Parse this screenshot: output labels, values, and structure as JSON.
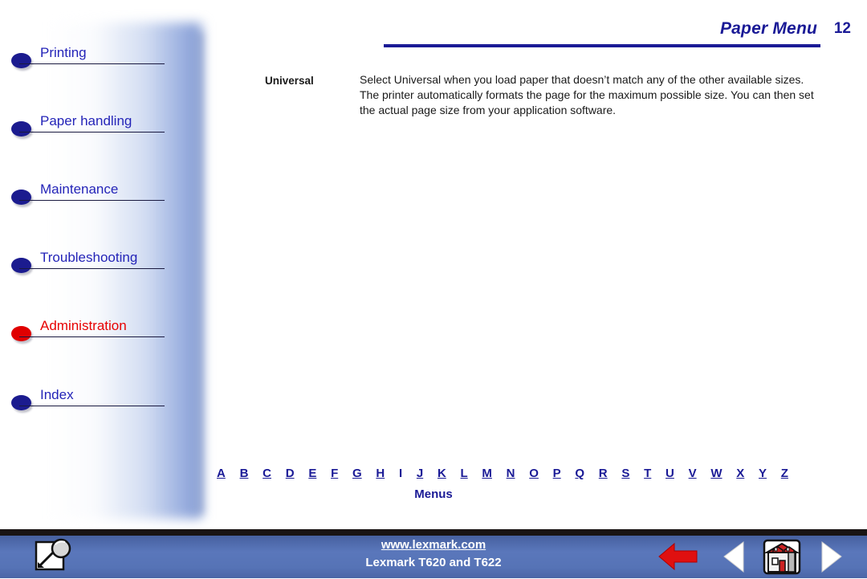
{
  "header": {
    "title": "Paper Menu",
    "page_number": "12",
    "rule_color": "#1a1a96"
  },
  "sidebar": {
    "items": [
      {
        "label": "Printing",
        "bullet": "blue",
        "active": false
      },
      {
        "label": "Paper handling",
        "bullet": "blue",
        "active": false
      },
      {
        "label": "Maintenance",
        "bullet": "blue",
        "active": false
      },
      {
        "label": "Troubleshooting",
        "bullet": "blue",
        "active": false
      },
      {
        "label": "Administration",
        "bullet": "red",
        "active": true
      },
      {
        "label": "Index",
        "bullet": "blue",
        "active": false
      }
    ],
    "active_color": "#e70000",
    "link_color": "#2424b8"
  },
  "main": {
    "entries": [
      {
        "term": "Universal",
        "description": "Select Universal when you load paper that doesn’t match any of the other available sizes. The printer automatically formats the page for the maximum possible size. You can then set the actual page size from your application software."
      }
    ]
  },
  "alpha_index": {
    "letters": [
      {
        "letter": "A",
        "underlined": true
      },
      {
        "letter": "B",
        "underlined": true
      },
      {
        "letter": "C",
        "underlined": true
      },
      {
        "letter": "D",
        "underlined": true
      },
      {
        "letter": "E",
        "underlined": true
      },
      {
        "letter": "F",
        "underlined": true
      },
      {
        "letter": "G",
        "underlined": true
      },
      {
        "letter": "H",
        "underlined": true
      },
      {
        "letter": "I",
        "underlined": false
      },
      {
        "letter": "J",
        "underlined": true
      },
      {
        "letter": "K",
        "underlined": true
      },
      {
        "letter": "L",
        "underlined": true
      },
      {
        "letter": "M",
        "underlined": true
      },
      {
        "letter": "N",
        "underlined": true
      },
      {
        "letter": "O",
        "underlined": true
      },
      {
        "letter": "P",
        "underlined": true
      },
      {
        "letter": "Q",
        "underlined": true
      },
      {
        "letter": "R",
        "underlined": true
      },
      {
        "letter": "S",
        "underlined": true
      },
      {
        "letter": "T",
        "underlined": true
      },
      {
        "letter": "U",
        "underlined": true
      },
      {
        "letter": "V",
        "underlined": true
      },
      {
        "letter": "W",
        "underlined": true
      },
      {
        "letter": "X",
        "underlined": true
      },
      {
        "letter": "Y",
        "underlined": true
      },
      {
        "letter": "Z",
        "underlined": true
      }
    ],
    "caption": "Menus"
  },
  "footer": {
    "url": "www.lexmark.com",
    "model": "Lexmark T620 and T622",
    "background_color": "#5673b6",
    "icons": {
      "search": "search-icon",
      "back": "back-arrow-icon",
      "previous": "previous-page-icon",
      "home": "home-icon",
      "next": "next-page-icon"
    },
    "back_arrow_color": "#e01010"
  }
}
